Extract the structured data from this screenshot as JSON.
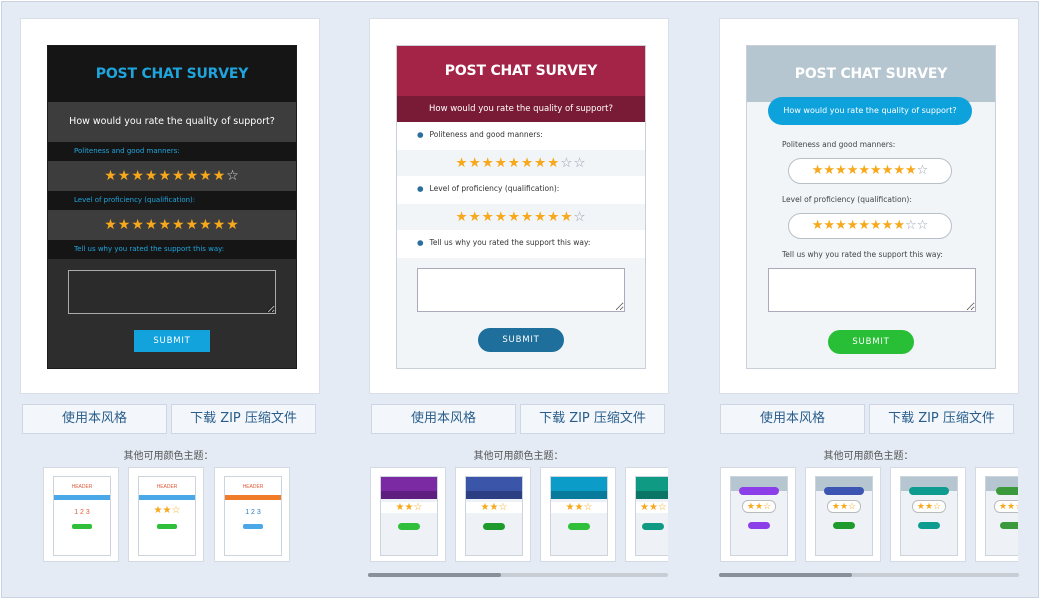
{
  "cards": [
    {
      "title": "POST CHAT SURVEY",
      "question": "How would you rate the quality of support?",
      "q1": "Politeness and good manners:",
      "q1_stars": "★★★★★★★★★☆",
      "q2": "Level of proficiency (qualification):",
      "q2_stars": "★★★★★★★★★★",
      "q3": "Tell us why you rated the support this way:",
      "submit": "SUBMIT"
    },
    {
      "title": "POST CHAT SURVEY",
      "question": "How would you rate the quality of support?",
      "q1": "Politeness and good manners:",
      "q1_stars": "★★★★★★★★☆☆",
      "q2": "Level of proficiency (qualification):",
      "q2_stars": "★★★★★★★★★☆",
      "q3": "Tell us why you rated the support this way:",
      "submit": "SUBMIT"
    },
    {
      "title": "POST CHAT SURVEY",
      "question": "How would you rate the quality of support?",
      "q1": "Politeness and good manners:",
      "q1_stars": "★★★★★★★★★☆",
      "q2": "Level of proficiency (qualification):",
      "q2_stars": "★★★★★★★★☆☆",
      "q3": "Tell us why you rated the support this way:",
      "submit": "SUBMIT"
    }
  ],
  "buttons": {
    "use_style": "使用本风格",
    "download_zip": "下载 ZIP 压缩文件"
  },
  "other_themes_label": "其他可用颜色主题：",
  "mini_header": "HEADER",
  "mini_numbers": "1 2 3",
  "mini_stars": "★★☆",
  "colors": {
    "dark_accent": "#1fa5dd",
    "crimson": "#a42448",
    "light_header": "#b5c6d0",
    "green": "#28bf36",
    "star": "#f7a81b"
  },
  "theme_swatches": {
    "col1": [
      "#4aa8e8",
      "#4aa8e8",
      "#f07c2a"
    ],
    "col2": [
      "#7c2aa3",
      "#3b56a8",
      "#0b9cc8",
      "#0f9a83"
    ],
    "col3": [
      "#8c3ee8",
      "#3c55b3",
      "#0d9c8f",
      "#3b9a3b"
    ]
  }
}
